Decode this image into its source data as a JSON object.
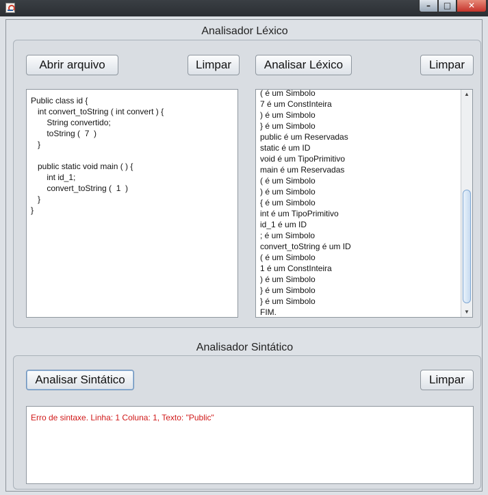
{
  "window": {
    "app_icon": "java-icon"
  },
  "lexico": {
    "title": "Analisador Léxico",
    "open_button": "Abrir arquivo",
    "clear_left": "Limpar",
    "analyze_button": "Analisar Léxico",
    "clear_right": "Limpar",
    "source_lines": [
      "Public class id {",
      "   int convert_toString ( int convert ) {",
      "       String convertido;",
      "       toString (  7  )",
      "   }",
      "",
      "   public static void main ( ) {",
      "       int id_1;",
      "       convert_toString (  1  )",
      "   }",
      "}"
    ],
    "tokens": [
      "( é um Simbolo",
      "7 é um ConstInteira",
      ") é um Simbolo",
      "} é um Simbolo",
      "public é um Reservadas",
      "static é um ID",
      "void é um TipoPrimitivo",
      "main é um Reservadas",
      "( é um Simbolo",
      ") é um Simbolo",
      "{ é um Simbolo",
      "int é um TipoPrimitivo",
      "id_1 é um ID",
      "; é um Simbolo",
      "convert_toString é um ID",
      "( é um Simbolo",
      "1 é um ConstInteira",
      ") é um Simbolo",
      "} é um Simbolo",
      "} é um Simbolo",
      "FIM."
    ],
    "scroll_position": 1.0
  },
  "sintatico": {
    "title": "Analisador Sintático",
    "analyze_button": "Analisar Sintático",
    "clear": "Limpar",
    "output": "Erro de sintaxe. Linha: 1 Coluna: 1, Texto: \"Public\""
  }
}
